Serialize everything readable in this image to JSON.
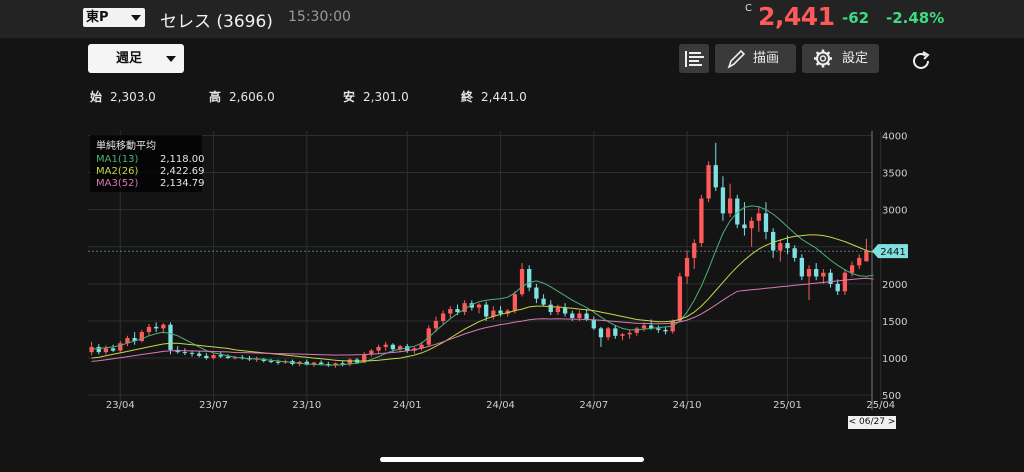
{
  "header": {
    "market": "東P",
    "stock_name": "セレス (3696)",
    "time": "15:30:00",
    "price_flag": "C",
    "price": "2,441",
    "change": "-62",
    "change_pct": "-2.48%"
  },
  "toolbar": {
    "period": "週足",
    "draw_label": "描画",
    "settings_label": "設定"
  },
  "ohlc": {
    "open_label": "始",
    "open": "2,303.0",
    "high_label": "高",
    "high": "2,606.0",
    "low_label": "安",
    "low": "2,301.0",
    "close_label": "終",
    "close": "2,441.0"
  },
  "legend": {
    "title": "単純移動平均",
    "items": [
      {
        "label": "MA1(13)",
        "value": "2,118.00",
        "color": "#4caf7a"
      },
      {
        "label": "MA2(26)",
        "value": "2,422.69",
        "color": "#c6d84a"
      },
      {
        "label": "MA3(52)",
        "value": "2,134.79",
        "color": "#d87ab4"
      }
    ]
  },
  "colors": {
    "up": "#ff5a5a",
    "down": "#7ee0e0",
    "accent": "#e53935"
  },
  "chart_data": {
    "type": "candlestick",
    "y_ticks": [
      "4000",
      "3500",
      "3000",
      "2500",
      "2000",
      "1500",
      "1000",
      "500"
    ],
    "ylim": [
      300,
      4060
    ],
    "x_labels": [
      "23/04",
      "23/07",
      "23/10",
      "24/01",
      "24/04",
      "24/07",
      "24/10",
      "25/01",
      "25/04"
    ],
    "last_price_tag": "2441",
    "date_tag": "< 06/27 >",
    "candles": [
      [
        1080,
        1220,
        1040,
        1150
      ],
      [
        1150,
        1190,
        1050,
        1080
      ],
      [
        1080,
        1170,
        1050,
        1130
      ],
      [
        1130,
        1180,
        1080,
        1100
      ],
      [
        1100,
        1230,
        1080,
        1200
      ],
      [
        1200,
        1300,
        1160,
        1270
      ],
      [
        1270,
        1350,
        1180,
        1230
      ],
      [
        1230,
        1380,
        1210,
        1350
      ],
      [
        1350,
        1460,
        1300,
        1420
      ],
      [
        1420,
        1480,
        1350,
        1400
      ],
      [
        1400,
        1470,
        1330,
        1450
      ],
      [
        1450,
        1480,
        1050,
        1110
      ],
      [
        1110,
        1160,
        1060,
        1080
      ],
      [
        1080,
        1130,
        1040,
        1070
      ],
      [
        1070,
        1100,
        1020,
        1060
      ],
      [
        1060,
        1090,
        1010,
        1030
      ],
      [
        1030,
        1070,
        980,
        1000
      ],
      [
        1000,
        1060,
        980,
        1040
      ],
      [
        1040,
        1080,
        1000,
        1020
      ],
      [
        1020,
        1050,
        990,
        1000
      ],
      [
        1000,
        1030,
        980,
        1010
      ],
      [
        1010,
        1040,
        980,
        1000
      ],
      [
        1000,
        1030,
        960,
        980
      ],
      [
        980,
        1020,
        950,
        990
      ],
      [
        990,
        1000,
        940,
        960
      ],
      [
        960,
        990,
        930,
        950
      ],
      [
        950,
        980,
        910,
        940
      ],
      [
        940,
        980,
        920,
        960
      ],
      [
        960,
        980,
        900,
        920
      ],
      [
        920,
        960,
        890,
        950
      ],
      [
        950,
        980,
        900,
        910
      ],
      [
        910,
        950,
        880,
        940
      ],
      [
        940,
        970,
        900,
        920
      ],
      [
        920,
        950,
        880,
        900
      ],
      [
        900,
        940,
        870,
        930
      ],
      [
        930,
        960,
        890,
        920
      ],
      [
        920,
        1000,
        890,
        980
      ],
      [
        980,
        1000,
        920,
        940
      ],
      [
        940,
        1080,
        930,
        1050
      ],
      [
        1050,
        1120,
        1020,
        1100
      ],
      [
        1100,
        1180,
        1060,
        1150
      ],
      [
        1150,
        1220,
        1100,
        1180
      ],
      [
        1180,
        1200,
        1080,
        1120
      ],
      [
        1120,
        1180,
        1080,
        1160
      ],
      [
        1160,
        1190,
        1070,
        1100
      ],
      [
        1100,
        1150,
        1060,
        1130
      ],
      [
        1130,
        1220,
        1100,
        1180
      ],
      [
        1180,
        1440,
        1160,
        1400
      ],
      [
        1400,
        1560,
        1350,
        1500
      ],
      [
        1500,
        1640,
        1460,
        1600
      ],
      [
        1600,
        1700,
        1540,
        1660
      ],
      [
        1660,
        1720,
        1580,
        1620
      ],
      [
        1620,
        1780,
        1580,
        1740
      ],
      [
        1740,
        1780,
        1640,
        1680
      ],
      [
        1680,
        1740,
        1600,
        1720
      ],
      [
        1720,
        1760,
        1500,
        1560
      ],
      [
        1560,
        1700,
        1520,
        1640
      ],
      [
        1640,
        1700,
        1560,
        1600
      ],
      [
        1600,
        1660,
        1560,
        1640
      ],
      [
        1640,
        1900,
        1600,
        1860
      ],
      [
        1860,
        2280,
        1830,
        2200
      ],
      [
        2200,
        2250,
        1900,
        1950
      ],
      [
        1950,
        2000,
        1740,
        1800
      ],
      [
        1800,
        1860,
        1700,
        1720
      ],
      [
        1720,
        1780,
        1580,
        1620
      ],
      [
        1620,
        1720,
        1580,
        1680
      ],
      [
        1680,
        1740,
        1560,
        1600
      ],
      [
        1600,
        1640,
        1500,
        1540
      ],
      [
        1540,
        1640,
        1500,
        1600
      ],
      [
        1600,
        1660,
        1500,
        1520
      ],
      [
        1520,
        1560,
        1380,
        1400
      ],
      [
        1400,
        1420,
        1150,
        1280
      ],
      [
        1280,
        1420,
        1240,
        1400
      ],
      [
        1400,
        1440,
        1260,
        1300
      ],
      [
        1300,
        1340,
        1240,
        1320
      ],
      [
        1320,
        1380,
        1260,
        1340
      ],
      [
        1340,
        1420,
        1300,
        1400
      ],
      [
        1400,
        1480,
        1360,
        1440
      ],
      [
        1440,
        1520,
        1380,
        1400
      ],
      [
        1400,
        1440,
        1340,
        1380
      ],
      [
        1380,
        1420,
        1320,
        1360
      ],
      [
        1360,
        1520,
        1330,
        1500
      ],
      [
        1500,
        2150,
        1480,
        2100
      ],
      [
        2100,
        2450,
        2000,
        2350
      ],
      [
        2350,
        2600,
        2200,
        2550
      ],
      [
        2550,
        3200,
        2500,
        3150
      ],
      [
        3150,
        3650,
        3100,
        3600
      ],
      [
        3600,
        3900,
        3250,
        3300
      ],
      [
        3300,
        3450,
        2850,
        2950
      ],
      [
        2950,
        3350,
        2900,
        3150
      ],
      [
        3150,
        3200,
        2750,
        2800
      ],
      [
        2800,
        3100,
        2650,
        2750
      ],
      [
        2750,
        2900,
        2500,
        2850
      ],
      [
        2850,
        3050,
        2700,
        2950
      ],
      [
        2950,
        3100,
        2600,
        2700
      ],
      [
        2700,
        2750,
        2350,
        2450
      ],
      [
        2450,
        2600,
        2300,
        2550
      ],
      [
        2550,
        2650,
        2400,
        2480
      ],
      [
        2480,
        2520,
        2300,
        2350
      ],
      [
        2350,
        2400,
        2050,
        2100
      ],
      [
        2100,
        2250,
        1780,
        2200
      ],
      [
        2200,
        2280,
        2050,
        2100
      ],
      [
        2100,
        2200,
        2000,
        2150
      ],
      [
        2150,
        2200,
        1950,
        2000
      ],
      [
        2000,
        2060,
        1850,
        1900
      ],
      [
        1900,
        2200,
        1850,
        2150
      ],
      [
        2150,
        2300,
        2100,
        2250
      ],
      [
        2250,
        2400,
        2200,
        2350
      ],
      [
        2303,
        2606,
        2301,
        2441
      ]
    ],
    "ma1": [
      1120,
      1130,
      1140,
      1150,
      1170,
      1200,
      1230,
      1260,
      1300,
      1330,
      1350,
      1330,
      1300,
      1250,
      1200,
      1150,
      1100,
      1070,
      1050,
      1030,
      1010,
      1000,
      990,
      990,
      980,
      970,
      960,
      950,
      940,
      930,
      920,
      915,
      910,
      905,
      905,
      910,
      920,
      930,
      950,
      980,
      1020,
      1060,
      1100,
      1120,
      1140,
      1160,
      1200,
      1280,
      1370,
      1450,
      1530,
      1600,
      1660,
      1720,
      1760,
      1780,
      1790,
      1800,
      1820,
      1880,
      1960,
      2020,
      2040,
      2010,
      1960,
      1900,
      1840,
      1780,
      1730,
      1680,
      1620,
      1550,
      1490,
      1440,
      1400,
      1380,
      1380,
      1390,
      1400,
      1410,
      1420,
      1430,
      1500,
      1620,
      1780,
      1970,
      2200,
      2450,
      2680,
      2850,
      2960,
      3030,
      3050,
      3040,
      3000,
      2940,
      2860,
      2770,
      2680,
      2600,
      2540,
      2480,
      2400,
      2320,
      2250,
      2190,
      2140,
      2110,
      2100,
      2118
    ],
    "ma2": [
      1000,
      1010,
      1030,
      1050,
      1070,
      1090,
      1110,
      1130,
      1150,
      1170,
      1190,
      1200,
      1200,
      1190,
      1180,
      1170,
      1160,
      1150,
      1140,
      1130,
      1110,
      1100,
      1090,
      1080,
      1070,
      1060,
      1050,
      1040,
      1030,
      1020,
      1010,
      1000,
      990,
      980,
      970,
      965,
      960,
      960,
      960,
      965,
      970,
      980,
      990,
      1000,
      1020,
      1040,
      1070,
      1110,
      1160,
      1210,
      1270,
      1330,
      1390,
      1440,
      1490,
      1530,
      1560,
      1590,
      1610,
      1640,
      1660,
      1690,
      1700,
      1700,
      1690,
      1690,
      1680,
      1670,
      1660,
      1650,
      1640,
      1620,
      1600,
      1580,
      1560,
      1540,
      1520,
      1510,
      1500,
      1490,
      1490,
      1500,
      1520,
      1560,
      1620,
      1700,
      1800,
      1910,
      2020,
      2130,
      2230,
      2320,
      2400,
      2470,
      2520,
      2560,
      2590,
      2620,
      2640,
      2650,
      2660,
      2660,
      2650,
      2630,
      2600,
      2570,
      2530,
      2490,
      2450,
      2422
    ]
  }
}
